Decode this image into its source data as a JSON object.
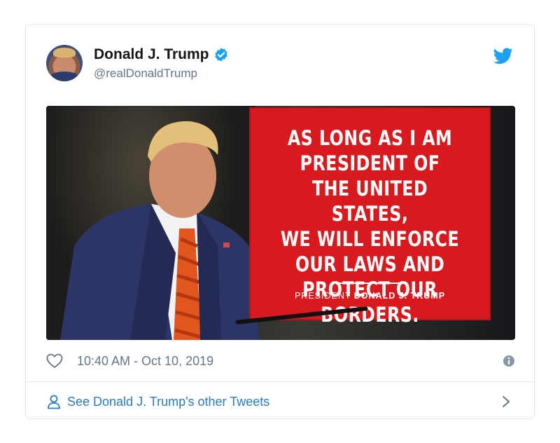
{
  "tweet": {
    "display_name": "Donald J. Trump",
    "handle": "@realDonaldTrump",
    "verified": true,
    "timestamp": "10:40 AM - Oct 10, 2019",
    "footer_link": "See Donald J. Trump's other Tweets"
  },
  "media": {
    "quote_lines": "AS LONG AS I AM\nPRESIDENT OF\nTHE UNITED STATES,\nWE WILL ENFORCE\nOUR LAWS AND\nPROTECT OUR BORDERS.",
    "attribution_prefix": "PRESIDENT",
    "attribution_name": "DONALD J. TRUMP"
  },
  "icons": {
    "verified": "verified-badge-icon",
    "brand": "twitter-bird-icon",
    "like": "heart-icon",
    "info": "info-icon",
    "profile": "person-icon",
    "more": "chevron-right-icon"
  },
  "colors": {
    "brand_blue": "#1da1f2",
    "link_blue": "#2b7bb9",
    "muted_gray": "#657786",
    "banner_red": "#d8191e"
  }
}
